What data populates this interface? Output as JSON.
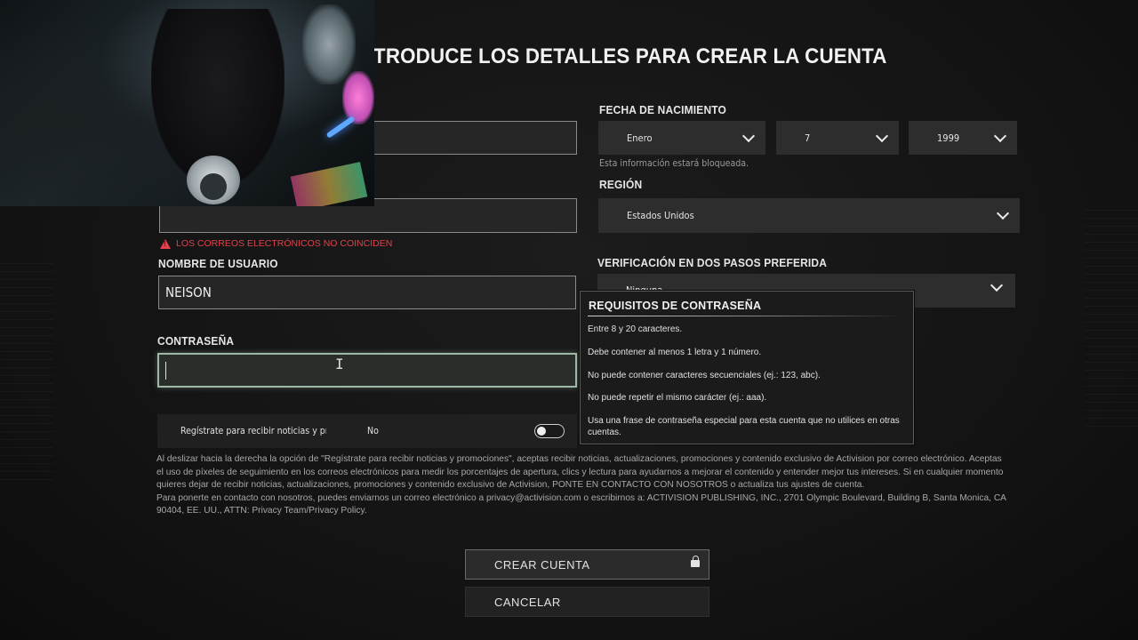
{
  "title": "TRODUCE LOS DETALLES PARA CREAR LA CUENTA",
  "form": {
    "birth_label": "FECHA DE NACIMIENTO",
    "birth_month": "Enero",
    "birth_day": "7",
    "birth_year": "1999",
    "birth_note": "Esta información estará bloqueada.",
    "region_label": "REGIÓN",
    "region_value": "Estados Unidos",
    "email_error": "LOS CORREOS ELECTRÓNICOS NO COINCIDEN",
    "username_label": "NOMBRE DE USUARIO",
    "username_value": "NEISON",
    "password_label": "CONTRASEÑA",
    "twofa_label": "VERIFICACIÓN EN DOS PASOS PREFERIDA",
    "twofa_value": "Ninguna",
    "newsletter_label": "Regístrate para recibir noticias y pro",
    "newsletter_value": "No"
  },
  "password_popup": {
    "title": "REQUISITOS DE CONTRASEÑA",
    "rules": [
      "Entre 8 y 20 caracteres.",
      "Debe contener al menos 1 letra y 1 número.",
      "No puede contener caracteres secuenciales (ej.: 123, abc).",
      "No puede repetir el mismo carácter (ej.: aaa).",
      "Usa una frase de contraseña especial para esta cuenta que no utilices en otras cuentas."
    ]
  },
  "legal": [
    "Al deslizar hacia la derecha la opción de \"Regístrate para recibir noticias y promociones\", aceptas recibir noticias, actualizaciones, promociones y contenido exclusivo de Activision por correo electrónico. Aceptas el uso de píxeles de seguimiento en los correos electrónicos para medir los porcentajes de apertura, clics y lectura para ayudarnos a mejorar el contenido y entender mejor tus intereses. Si en cualquier momento quieres dejar de recibir noticias, actualizaciones, promociones y contenido exclusivo de Activision, PONTE EN CONTACTO CON NOSOTROS o actualiza tus ajustes de cuenta.",
    "Para ponerte en contacto con nosotros, puedes enviarnos un correo electrónico a privacy@activision.com o escribirnos a: ACTIVISION PUBLISHING, INC., 2701 Olympic Boulevard, Building B, Santa Monica, CA 90404, EE. UU., ATTN: Privacy Team/Privacy Policy."
  ],
  "buttons": {
    "create": "CREAR CUENTA",
    "cancel": "CANCELAR"
  },
  "icons": {
    "chevron": "chevron-down-icon",
    "lock": "lock-icon",
    "warning": "warning-icon",
    "cursor": "text-cursor-icon"
  }
}
